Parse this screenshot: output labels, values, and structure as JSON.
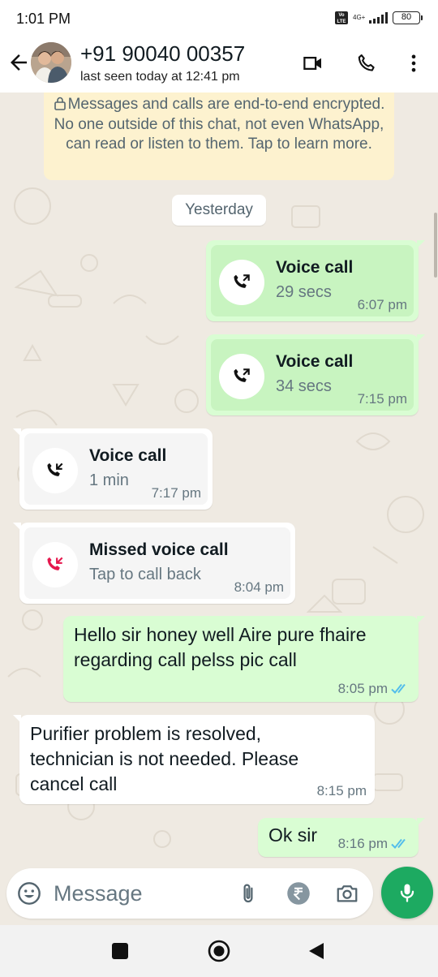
{
  "status_bar": {
    "time": "1:01 PM",
    "volte": "Vo LTE",
    "network": "4G+",
    "battery": "80"
  },
  "header": {
    "contact_name": "+91 90040 00357",
    "last_seen": "last seen today at 12:41 pm"
  },
  "chat": {
    "encryption_notice": "Messages and calls are end-to-end encrypted. No one outside of this chat, not even WhatsApp, can read or listen to them. Tap to learn more.",
    "date_label": "Yesterday",
    "messages": [
      {
        "type": "call",
        "direction": "outgoing",
        "title": "Voice call",
        "detail": "29 secs",
        "time": "6:07 pm"
      },
      {
        "type": "call",
        "direction": "outgoing",
        "title": "Voice call",
        "detail": "34 secs",
        "time": "7:15 pm"
      },
      {
        "type": "call",
        "direction": "incoming",
        "title": "Voice call",
        "detail": "1 min",
        "time": "7:17 pm"
      },
      {
        "type": "call",
        "direction": "missed",
        "title": "Missed voice call",
        "detail": "Tap to call back",
        "time": "8:04 pm"
      },
      {
        "type": "text",
        "direction": "outgoing",
        "lines": [
          "Hello sir honey well Aire pure fhaire",
          "regarding call pelss pic call"
        ],
        "time": "8:05 pm",
        "status": "read"
      },
      {
        "type": "text",
        "direction": "incoming",
        "lines": [
          "Purifier problem is resolved,",
          "technician is not needed. Please",
          "cancel call"
        ],
        "time": "8:15 pm"
      },
      {
        "type": "text",
        "direction": "outgoing",
        "lines": [
          "Ok sir"
        ],
        "time": "8:16 pm",
        "status": "read"
      }
    ]
  },
  "composer": {
    "placeholder": "Message"
  },
  "icons": {
    "back": "arrow-left-icon",
    "video": "video-camera-icon",
    "call": "phone-icon",
    "menu": "more-vertical-icon",
    "emoji": "emoji-icon",
    "attach": "paperclip-icon",
    "payment": "rupee-icon",
    "camera": "camera-icon",
    "mic": "microphone-icon",
    "nav_recents": "square-icon",
    "nav_home": "circle-icon",
    "nav_back": "triangle-back-icon"
  },
  "colors": {
    "outgoing_bubble": "#d9fdd3",
    "incoming_bubble": "#ffffff",
    "accent": "#1daa61",
    "read_ticks": "#53bdeb",
    "missed_call": "#e5184e",
    "banner": "#fdf2cf"
  }
}
